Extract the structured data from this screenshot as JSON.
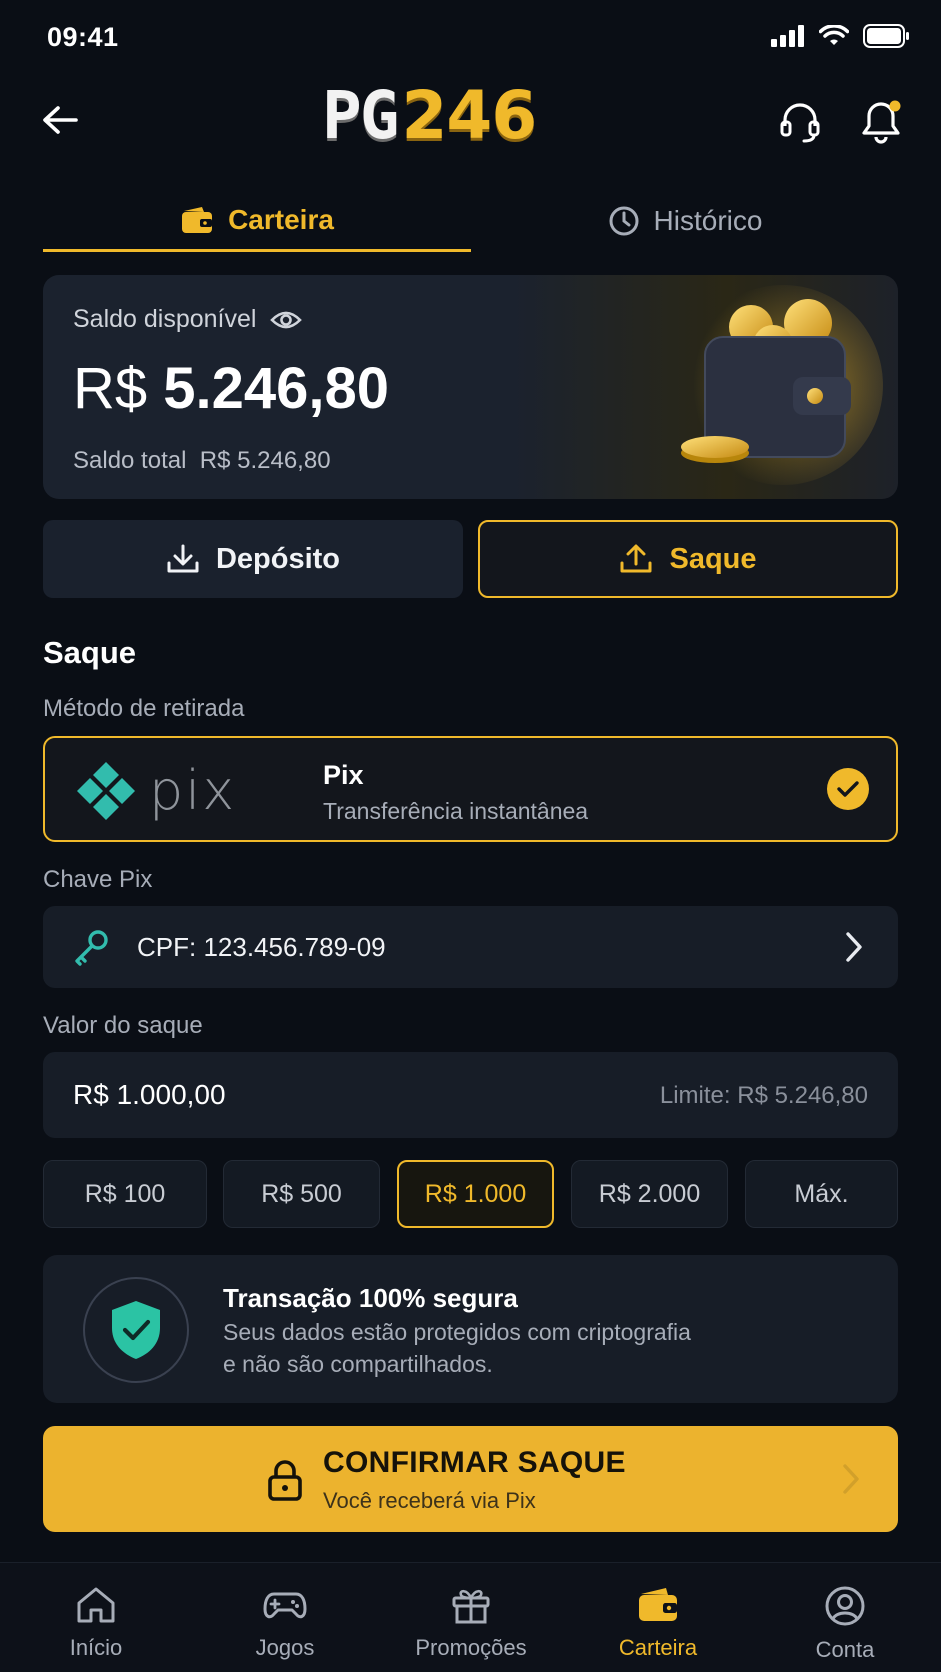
{
  "status_bar": {
    "time": "09:41"
  },
  "header": {
    "logo_left": "PG",
    "logo_right": "246"
  },
  "tabs": [
    {
      "label": "Carteira",
      "icon": "wallet-icon",
      "active": true
    },
    {
      "label": "Histórico",
      "icon": "clock-icon",
      "active": false
    }
  ],
  "balance": {
    "label": "Saldo disponível",
    "currency": "R$",
    "amount": "5.246,80",
    "total_label": "Saldo total",
    "total_value": "R$ 5.246,80"
  },
  "actions": {
    "deposit": "Depósito",
    "withdraw": "Saque"
  },
  "withdraw": {
    "title": "Saque",
    "method_label": "Método de retirada",
    "method_logo_text": "pix",
    "method_name": "Pix",
    "method_desc": "Transferência instantânea",
    "key_label": "Chave Pix",
    "key_value": "CPF: 123.456.789-09",
    "amount_label": "Valor do saque",
    "amount_value": "R$ 1.000,00",
    "amount_limit": "Limite: R$ 5.246,80",
    "chips": [
      "R$ 100",
      "R$ 500",
      "R$ 1.000",
      "R$ 2.000",
      "Máx."
    ],
    "active_chip": "R$ 1.000"
  },
  "security": {
    "title": "Transação 100% segura",
    "line1": "Seus dados estão protegidos com criptografia",
    "line2": "e não são compartilhados."
  },
  "confirm": {
    "title": "CONFIRMAR SAQUE",
    "subtitle": "Você receberá via Pix"
  },
  "bottom_nav": [
    {
      "label": "Início",
      "icon": "home-icon"
    },
    {
      "label": "Jogos",
      "icon": "gamepad-icon"
    },
    {
      "label": "Promoções",
      "icon": "gift-icon"
    },
    {
      "label": "Carteira",
      "icon": "wallet-icon",
      "active": true
    },
    {
      "label": "Conta",
      "icon": "user-icon"
    }
  ],
  "colors": {
    "accent": "#f0b92b",
    "background": "#0a0e15",
    "card": "#171d27",
    "pix_green": "#32bcad"
  }
}
